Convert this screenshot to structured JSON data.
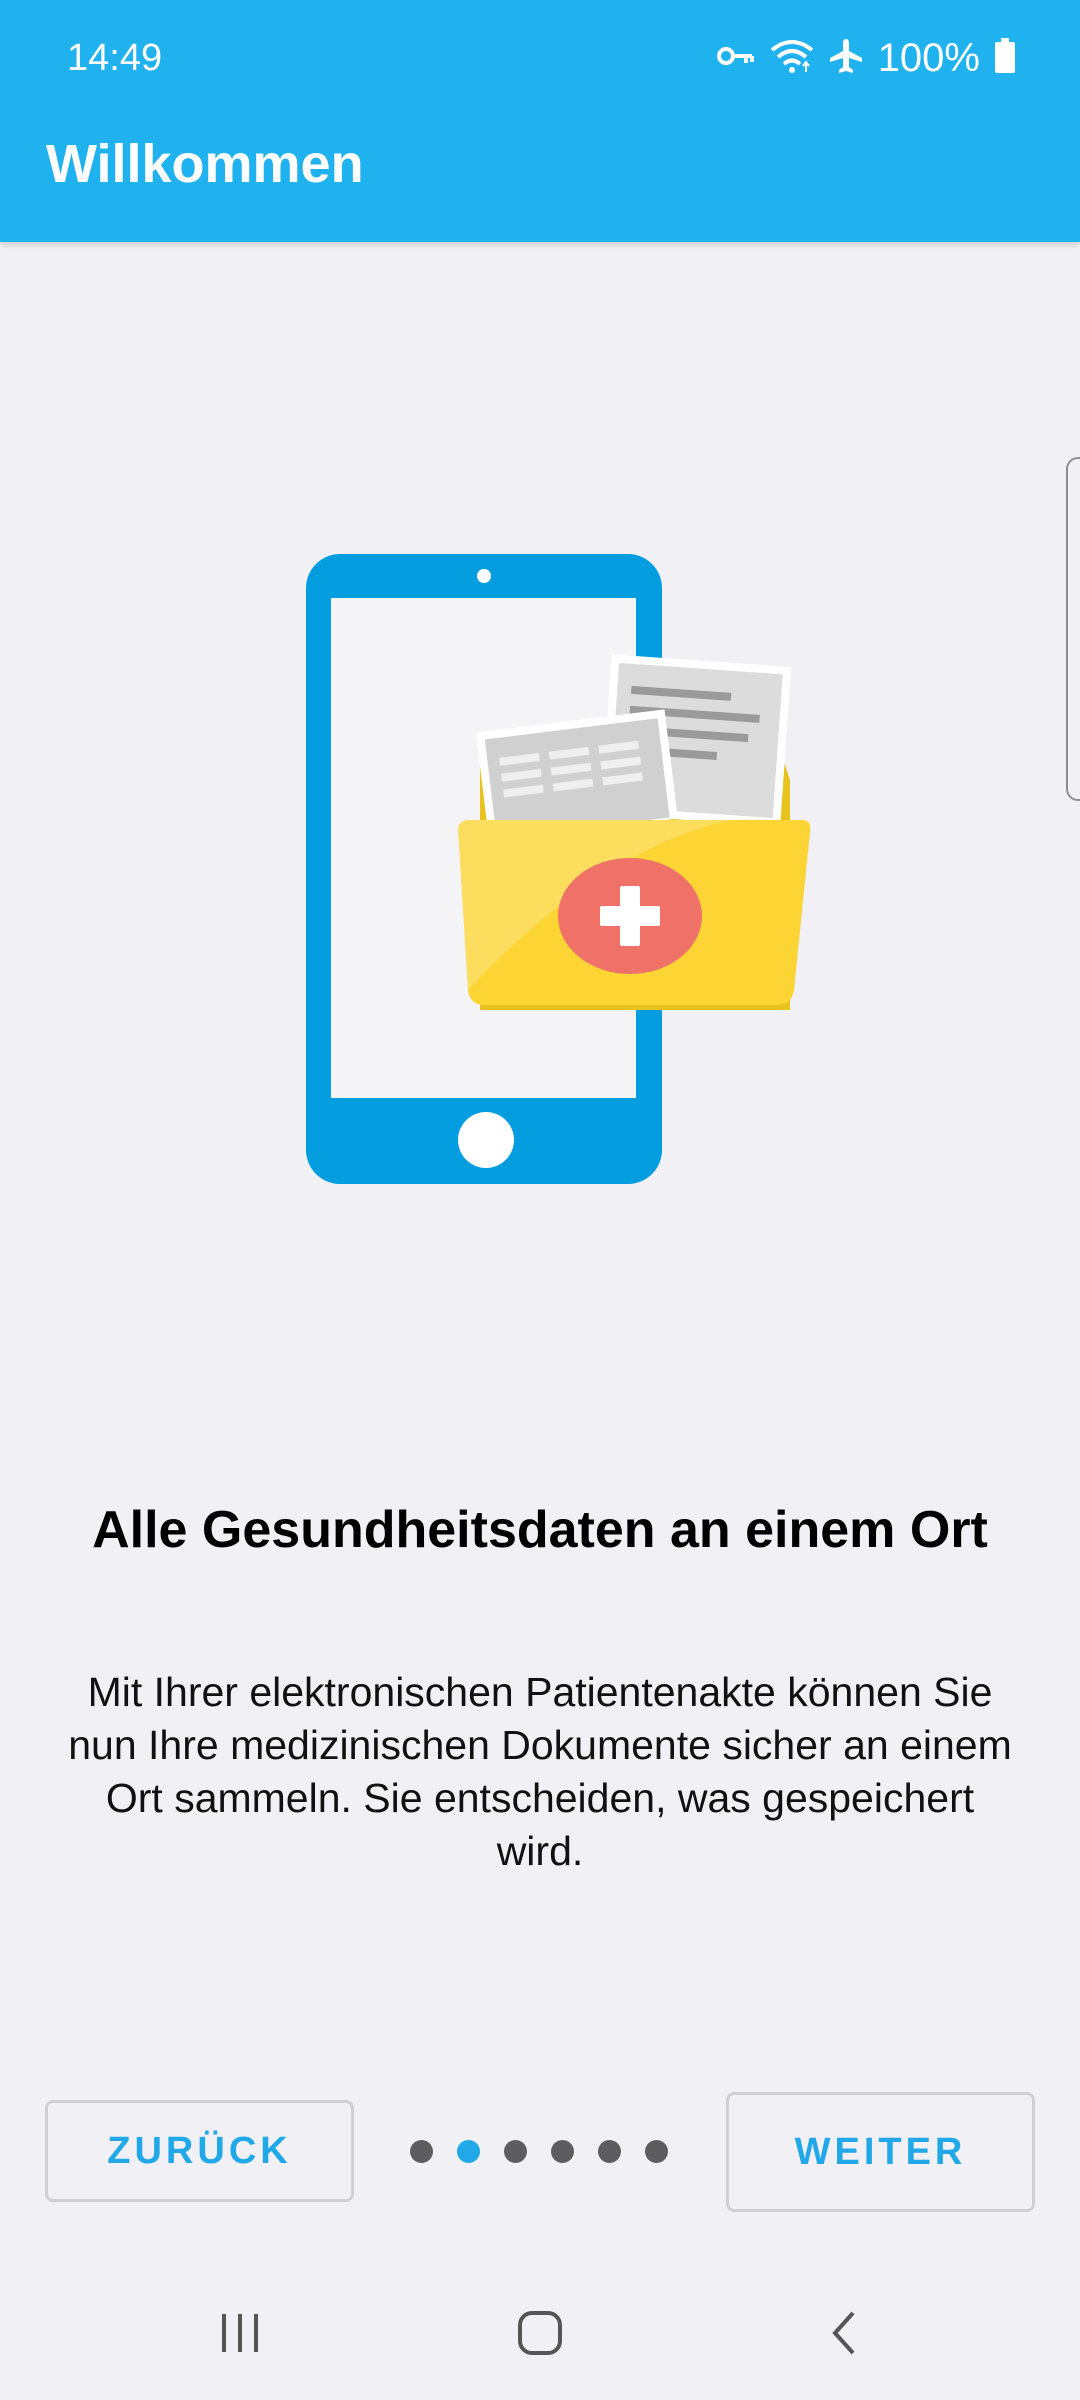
{
  "status_bar": {
    "time": "14:49",
    "battery_percent": "100%",
    "icons": [
      "key-icon",
      "wifi-icon",
      "airplane-mode-icon",
      "battery-icon"
    ]
  },
  "app_bar": {
    "title": "Willkommen"
  },
  "onboarding": {
    "illustration": "phone-with-medical-folder",
    "headline": "Alle Gesundheitsdaten an einem Ort",
    "description": "Mit Ihrer elektronischen Patientenakte können Sie nun Ihre medizinischen Dokumente sicher an einem Ort sammeln. Sie entscheiden, was gespeichert wird.",
    "page_indicator": {
      "total": 6,
      "current": 2
    }
  },
  "controls": {
    "back_label": "ZURÜCK",
    "next_label": "WEITER"
  },
  "nav_bar": {
    "icons": [
      "recent-apps-icon",
      "home-icon",
      "back-icon"
    ]
  },
  "colors": {
    "app_bar": "#20b2ee",
    "accent": "#20a8e8",
    "background": "#f1f0f5",
    "phone": "#049de0",
    "folder": "#fcd434",
    "medical_badge": "#ef7168"
  }
}
